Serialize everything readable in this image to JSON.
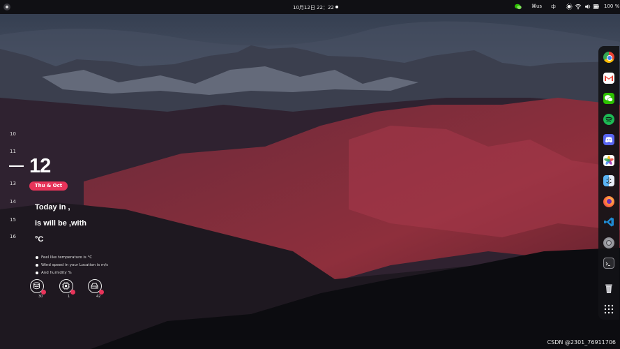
{
  "topbar": {
    "clock": "10月12日  22：22",
    "keyboard_layout": "⌘us",
    "input_method": "中",
    "battery": "100 %"
  },
  "widget": {
    "hours_above": [
      "10",
      "11"
    ],
    "current_hour": "12",
    "hours_below": [
      "13",
      "14",
      "15",
      "16"
    ],
    "date_label": "Thu & Oct",
    "weather_lines": [
      "Today in ,",
      "is will be ,with",
      "°C"
    ],
    "details": [
      "Feel like temperature is °C",
      "Wind speed in your Location is  m/s",
      "And humidity %"
    ],
    "gauges": [
      {
        "icon": "database-icon",
        "value": "30"
      },
      {
        "icon": "cpu-icon",
        "value": "1"
      },
      {
        "icon": "drive-icon",
        "value": "42"
      }
    ]
  },
  "dock": {
    "apps": [
      {
        "name": "chrome",
        "color": "#ffffff"
      },
      {
        "name": "gmail",
        "color": "#ffffff"
      },
      {
        "name": "wechat",
        "color": "#2dc100"
      },
      {
        "name": "spotify",
        "color": "#1db954"
      },
      {
        "name": "discord",
        "color": "#5865f2"
      },
      {
        "name": "photos",
        "color": "#ffffff"
      },
      {
        "name": "finder",
        "color": "#4aa3f0"
      },
      {
        "name": "firefox",
        "color": "#ff7139"
      },
      {
        "name": "vscode",
        "color": "#0078d4"
      },
      {
        "name": "system-settings",
        "color": "#9a9aa0"
      },
      {
        "name": "terminal",
        "color": "#2a2a2e"
      },
      {
        "name": "trash",
        "color": "#d8d8dc"
      },
      {
        "name": "app-grid",
        "color": "#ffffff"
      }
    ]
  },
  "watermark": "CSDN @2301_76911706",
  "colors": {
    "accent": "#e8345a",
    "topbar": "#101014",
    "dock": "#121216"
  }
}
